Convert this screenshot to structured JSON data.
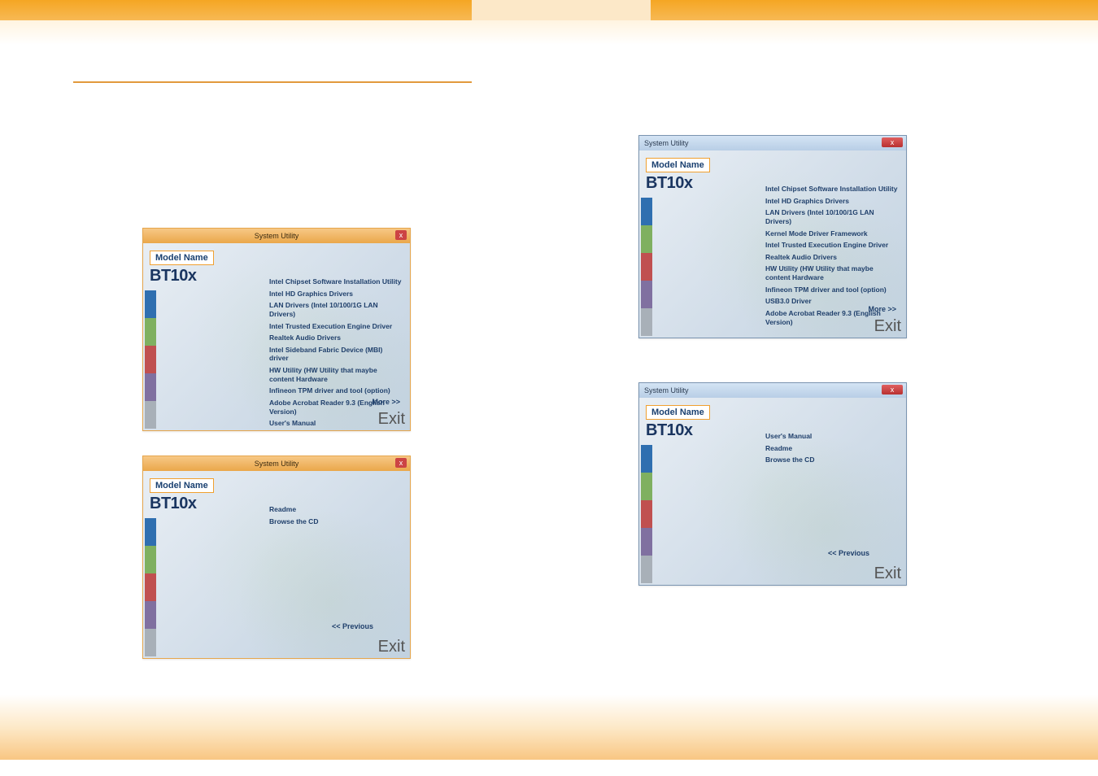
{
  "header": {
    "tab": ""
  },
  "panels": {
    "common": {
      "title": "System Utility",
      "close": "x",
      "model_label": "Model Name",
      "model_value": "BT10x",
      "exit": "Exit",
      "more": "More >>",
      "prev": "<< Previous"
    },
    "win8_p1": {
      "items": [
        "Intel Chipset Software Installation Utility",
        "Intel HD Graphics Drivers",
        "LAN Drivers    (Intel 10/100/1G LAN Drivers)",
        "Intel Trusted Execution Engine Driver",
        "Realtek Audio Drivers",
        "Intel Sideband Fabric Device (MBI) driver",
        "HW Utility  (HW Utility that maybe content Hardware",
        "Infineon TPM driver and tool (option)",
        "Adobe Acrobat Reader 9.3 (English Version)",
        "User's Manual"
      ]
    },
    "win8_p2": {
      "items": [
        "Readme",
        "Browse the CD"
      ]
    },
    "win7_p1": {
      "items": [
        "Intel Chipset Software Installation Utility",
        "Intel HD Graphics Drivers",
        "LAN Drivers    (Intel 10/100/1G LAN Drivers)",
        "Kernel Mode Driver Framework",
        "Intel Trusted Execution Engine Driver",
        "Realtek Audio Drivers",
        "HW Utility  (HW Utility that maybe content Hardware",
        "Infineon TPM driver and tool (option)",
        "USB3.0 Driver",
        "Adobe Acrobat Reader 9.3 (English Version)"
      ]
    },
    "win7_p2": {
      "items": [
        "User's Manual",
        "Readme",
        "Browse the CD"
      ]
    }
  }
}
